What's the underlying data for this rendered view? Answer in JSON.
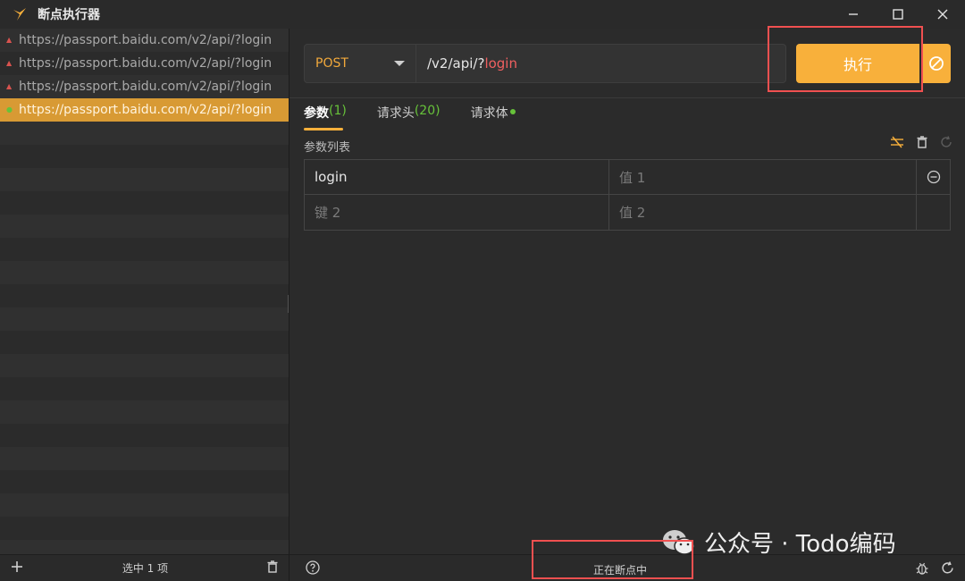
{
  "window": {
    "title": "断点执行器"
  },
  "left": {
    "rows": [
      {
        "url": "https://passport.baidu.com/v2/api/?login",
        "state": "up"
      },
      {
        "url": "https://passport.baidu.com/v2/api/?login",
        "state": "up"
      },
      {
        "url": "https://passport.baidu.com/v2/api/?login",
        "state": "up"
      },
      {
        "url": "https://passport.baidu.com/v2/api/?login",
        "state": "ok",
        "selected": true
      }
    ],
    "empty_rows": 19,
    "status": "选中 1 项"
  },
  "request": {
    "method": "POST",
    "url_path": "/v2/api/?",
    "url_query": "login",
    "execute_label": "执行"
  },
  "tabs": [
    {
      "label": "参数",
      "count": "(1)",
      "active": true
    },
    {
      "label": "请求头",
      "count": "(20)",
      "active": false
    },
    {
      "label": "请求体",
      "count": "",
      "active": false,
      "dot": true
    }
  ],
  "params": {
    "title": "参数列表",
    "rows": [
      {
        "key": "login",
        "value_placeholder": "值 1"
      },
      {
        "key_placeholder": "键 2",
        "value_placeholder": "值 2"
      }
    ]
  },
  "status_bar": {
    "center": "正在断点中"
  },
  "watermark": {
    "text": "公众号 · Todo编码"
  },
  "colors": {
    "accent": "#f8b03b",
    "highlight": "#f05050",
    "success": "#67c23a"
  }
}
